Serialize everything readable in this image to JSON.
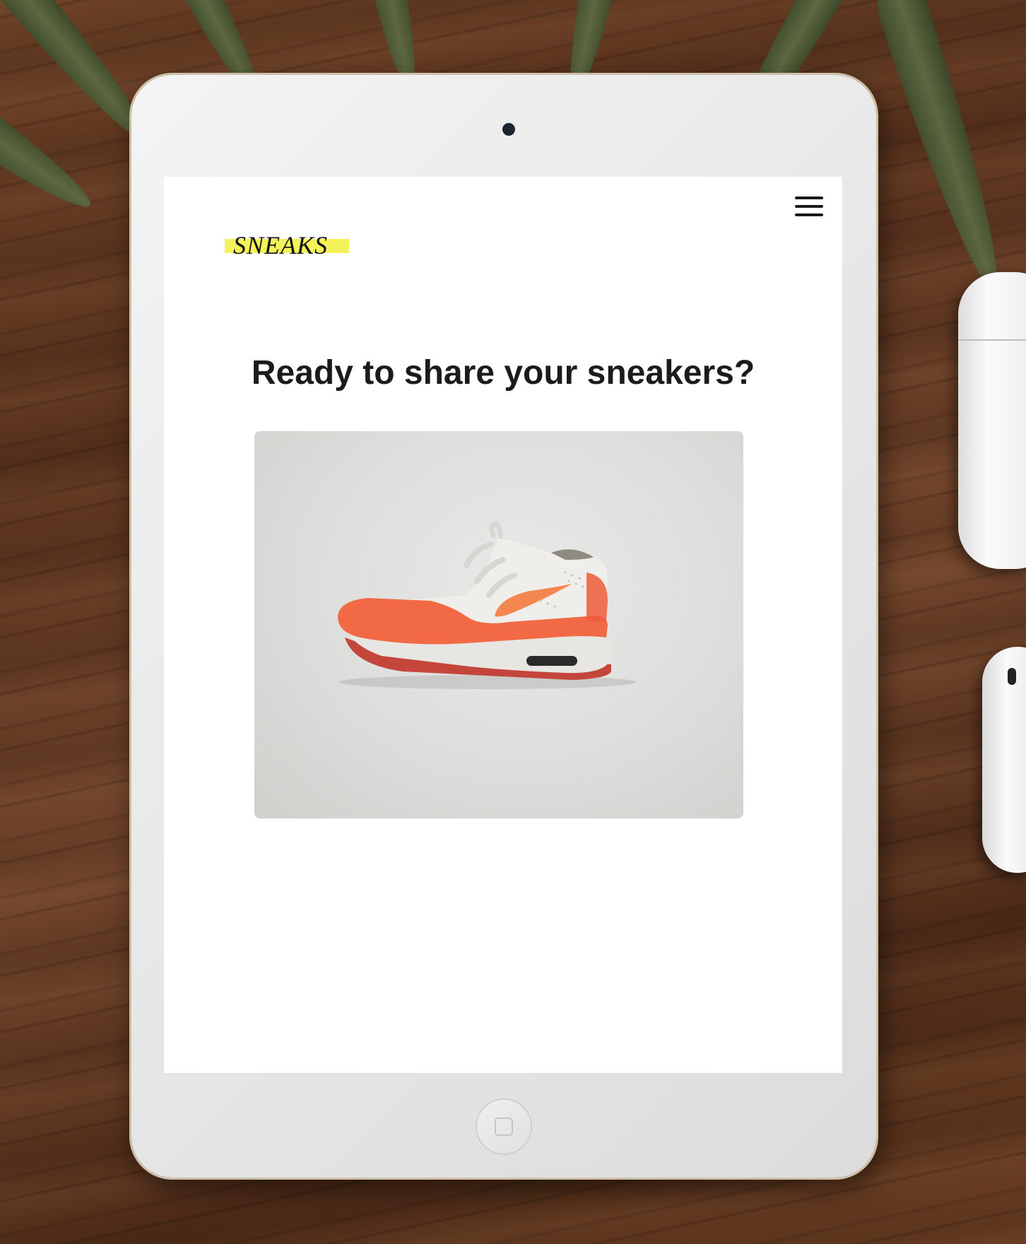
{
  "app": {
    "brand": "SNEAKS",
    "brand_highlight_color": "#f4f25a",
    "menu_icon": "hamburger-menu-icon"
  },
  "main": {
    "headline": "Ready to share your sneakers?",
    "image": {
      "subject": "orange-and-white-running-sneaker"
    }
  },
  "device": {
    "type": "tablet",
    "home_button_icon": "home-button-icon"
  }
}
